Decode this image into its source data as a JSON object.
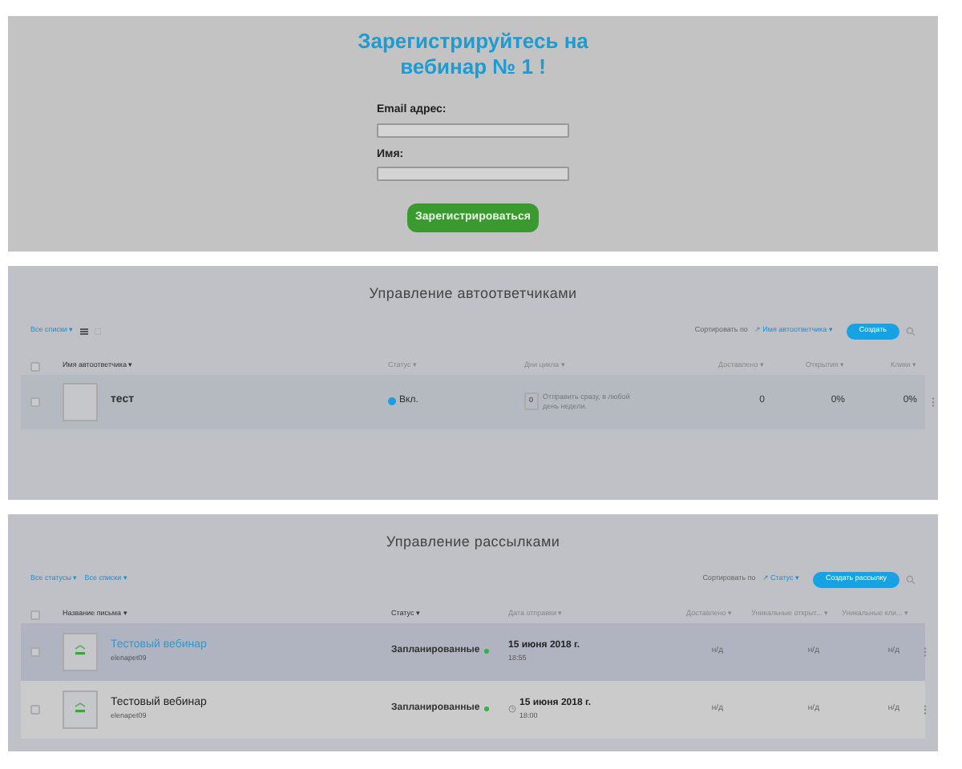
{
  "registration_form": {
    "title": "Зарегистрируйтесь на вебинар № 1 !",
    "fields": [
      {
        "label": "Email адрес:"
      },
      {
        "label": "Имя:"
      }
    ],
    "submit": "Зарегистрироваться"
  },
  "autoresponders": {
    "title": "Управление автоответчиками",
    "select_all_checked": false,
    "filters": [
      "Все списки ▾"
    ],
    "sort_label": "Сортировать по",
    "sort_value": "↗ Имя автоответчика ▾",
    "create": "Создать",
    "columns": [
      "Имя автоответчика ▾",
      "Статус ▾",
      "Дни цикла ▾",
      "Доставлено ▾",
      "Открытия ▾",
      "Клики ▾"
    ],
    "rows": [
      {
        "name": "тест",
        "checked": false,
        "highlighted": true,
        "on": true,
        "status": "Вкл.",
        "day": "0",
        "schedule": "Отправить сразу, в любой день недели.",
        "delivered": "0",
        "opens": "0%",
        "clicks": "0%"
      }
    ]
  },
  "mailings": {
    "title": "Управление рассылками",
    "select_all_checked": false,
    "filters": [
      "Все статусы ▾",
      "Все списки ▾"
    ],
    "sort_label": "Сортировать по",
    "sort_value": "↗ Статус ▾",
    "create": "Создать рассылку",
    "columns": [
      "Название письма ▾",
      "Статус ▾",
      "Дата отправки ▾",
      "Доставлено ▾",
      "Уникальные открыт... ▾",
      "Уникальные кли... ▾"
    ],
    "rows": [
      {
        "name": "Тестовый вебинар",
        "checked": false,
        "link": true,
        "highlighted": true,
        "author": "elenapet09",
        "status": "Запланированные",
        "date": "15 июня 2018 г.",
        "time": "18:55",
        "clock": false,
        "delivered": "н/д",
        "opens": "н/д",
        "clicks": "н/д"
      },
      {
        "name": "Тестовый вебинар",
        "checked": false,
        "link": false,
        "highlighted": false,
        "author": "elenapet09",
        "status": "Запланированные",
        "date": "15 июня 2018 г.",
        "time": "18:00",
        "clock": true,
        "delivered": "н/д",
        "opens": "н/д",
        "clicks": "н/д"
      }
    ]
  }
}
